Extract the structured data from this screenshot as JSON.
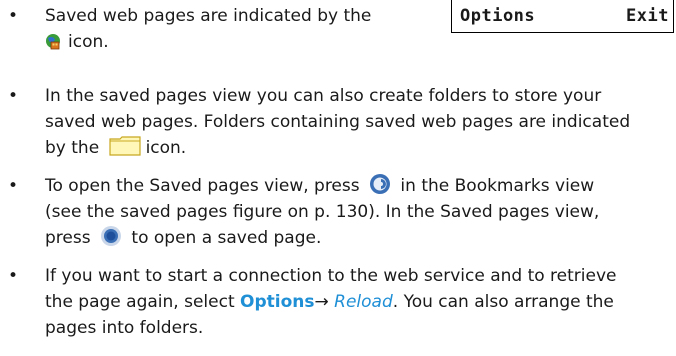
{
  "softkeys": {
    "left_label": "Options",
    "right_label": "Exit"
  },
  "bullet_symbol": "•",
  "bullets": [
    {
      "lines": [
        "Saved web pages are indicated by the",
        "icon."
      ]
    },
    {
      "lines": [
        "In the saved pages view you can also create folders to store your",
        "saved web pages. Folders containing saved web pages are indicated",
        "by the",
        "icon."
      ]
    },
    {
      "lines": [
        "To open the Saved pages view, press",
        "in the Bookmarks view",
        "(see the saved pages figure on p. 130). In the Saved pages view,",
        "press",
        "to open a saved page."
      ]
    },
    {
      "lines": [
        "If you want to start a connection to the web service and to retrieve",
        "the page again, select",
        "Options",
        "→",
        "Reload",
        ". You can also arrange the",
        "pages into folders."
      ]
    }
  ],
  "icons": {
    "saved_page": "saved-page-icon",
    "folder": "folder-icon",
    "navi_scroll": "navi-scroll-key-icon",
    "navi_select": "navi-select-key-icon"
  },
  "colors": {
    "link": "#1f8fd6",
    "text": "#1a1a1a"
  }
}
